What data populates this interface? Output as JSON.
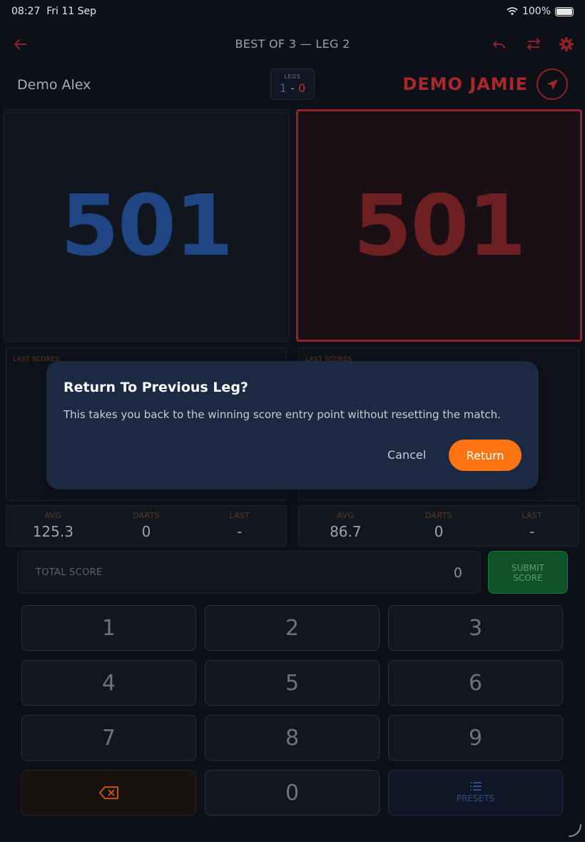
{
  "status": {
    "time": "08:27",
    "date": "Fri 11 Sep",
    "battery": "100%"
  },
  "header": {
    "title": "BEST OF 3 — LEG 2"
  },
  "players": {
    "left": {
      "name": "Demo Alex",
      "score": "501",
      "avg": "125.3",
      "darts": "0",
      "last": "-"
    },
    "right": {
      "name": "DEMO JAMIE",
      "score": "501",
      "avg": "86.7",
      "darts": "0",
      "last": "-"
    }
  },
  "legs": {
    "label": "LEGS",
    "left": "1",
    "sep": "-",
    "right": "0"
  },
  "labels": {
    "last_scores": "LAST SCORES",
    "avg": "AVG",
    "darts": "DARTS",
    "last": "LAST"
  },
  "entry": {
    "total_label": "TOTAL SCORE",
    "total_value": "0",
    "submit_line1": "SUBMIT",
    "submit_line2": "SCORE"
  },
  "keypad": {
    "keys": [
      "1",
      "2",
      "3",
      "4",
      "5",
      "6",
      "7",
      "8",
      "9",
      "0"
    ],
    "presets_label": "PRESETS"
  },
  "dialog": {
    "title": "Return To Previous Leg?",
    "body": "This takes you back to the winning score entry point without resetting the match.",
    "cancel": "Cancel",
    "confirm": "Return"
  },
  "colors": {
    "accent_orange": "#ff7412",
    "player_blue": "#1f4585",
    "player_red": "#a8282c",
    "submit_green": "#0f5227"
  },
  "icons": [
    "back-arrow-icon",
    "undo-icon",
    "swap-icon",
    "gear-icon",
    "throw-arrow-icon",
    "backspace-icon",
    "list-icon",
    "wifi-icon",
    "battery-icon"
  ]
}
